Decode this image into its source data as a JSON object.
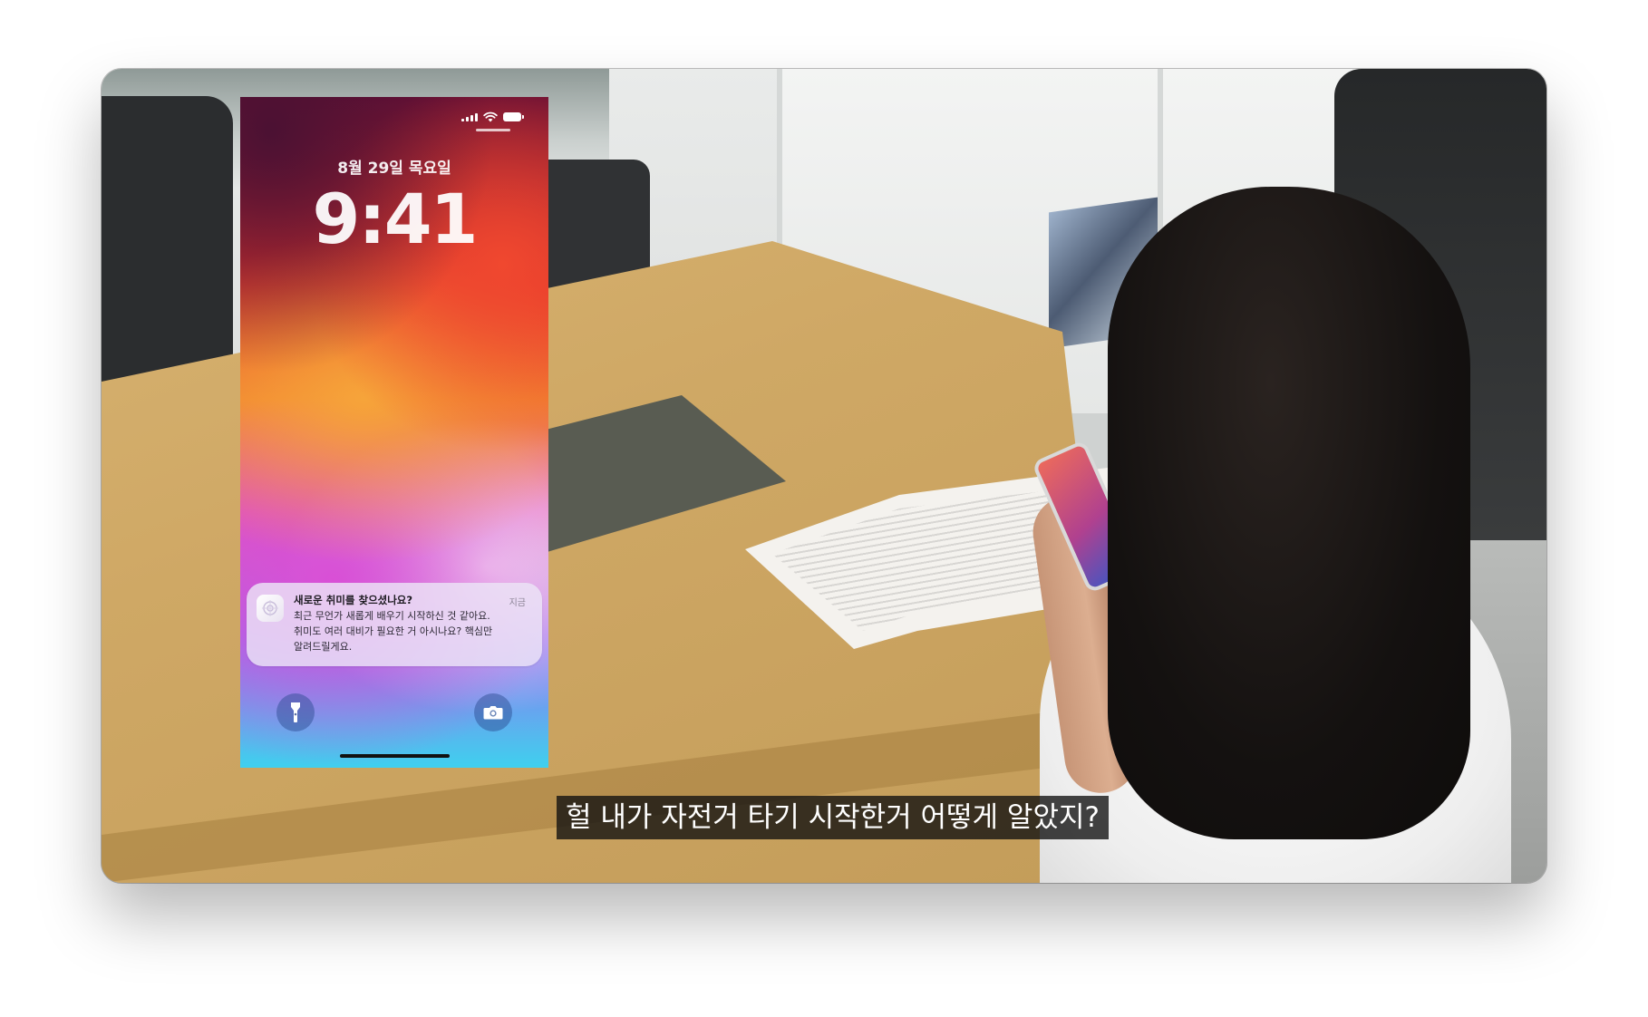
{
  "lock_screen": {
    "date": "8월 29일 목요일",
    "time": "9:41",
    "status_icons": [
      "cellular-signal-icon",
      "wifi-icon",
      "battery-icon"
    ],
    "notification": {
      "app_icon": "app-icon",
      "title": "새로운 취미를 찾으셨나요?",
      "time": "지금",
      "body": "최근 무언가 새롭게 배우기 시작하신 것 같아요.\n취미도 여러 대비가 필요한 거 아시나요? 핵심만\n알려드릴게요."
    },
    "quick_actions": [
      {
        "name": "flashlight",
        "icon": "flashlight-icon"
      },
      {
        "name": "camera",
        "icon": "camera-icon"
      }
    ]
  },
  "video": {
    "subtitle": "헐 내가 자전거 타기 시작한거 어떻게 알았지?"
  },
  "colors": {
    "subtitle_background": "#0f0f0f",
    "notification_background": "#ece4f6"
  }
}
